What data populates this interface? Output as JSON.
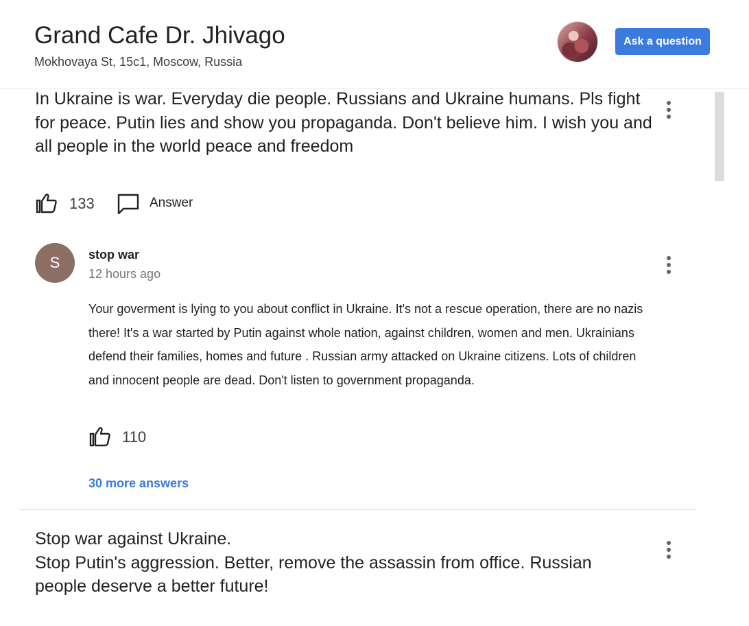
{
  "header": {
    "title": "Grand Cafe Dr. Jhivago",
    "address": "Mokhovaya St, 15c1, Moscow, Russia",
    "ask_button": "Ask a question"
  },
  "question1": {
    "text": "In Ukraine is war. Everyday die people. Russians and Ukraine humans. Pls fight for peace. Putin lies and show you propaganda. Don't believe him. I wish you and all people in the world peace and freedom",
    "likes": "133",
    "answer_label": "Answer",
    "answer": {
      "avatar_letter": "S",
      "author": "stop war",
      "time": "12 hours ago",
      "text": "Your goverment is lying to you about conflict in Ukraine. It's not a rescue operation, there are no nazis there! It's a war started by Putin against whole nation, against children, women and men. Ukrainians defend their families, homes and future . Russian army attacked on Ukraine citizens. Lots of children and innocent people are dead. Don't listen to government propaganda.",
      "likes": "110"
    },
    "more_answers": "30 more answers"
  },
  "question2": {
    "line1": "Stop war against Ukraine.",
    "line2": "Stop Putin's aggression. Better, remove the assassin from office. Russian people deserve a better future!"
  },
  "colors": {
    "accent": "#3b7be0",
    "avatar_letter_bg": "#8d6e63"
  },
  "icons": [
    "thumb-up-icon",
    "comment-icon",
    "more-vert-icon"
  ]
}
